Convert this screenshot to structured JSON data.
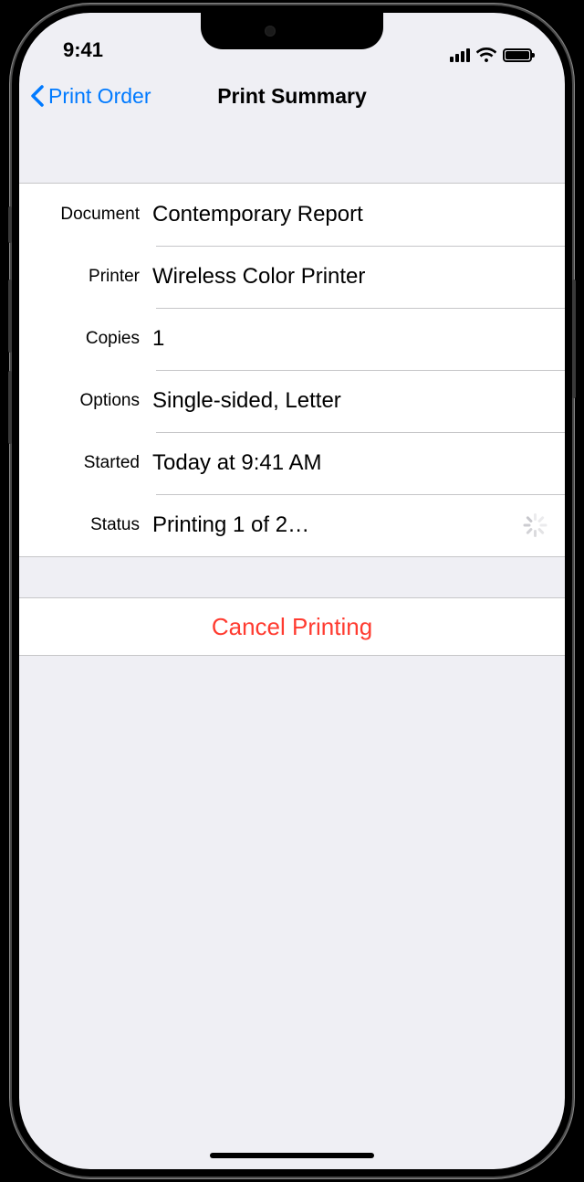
{
  "status_bar": {
    "time": "9:41"
  },
  "nav": {
    "back_label": "Print Order",
    "title": "Print Summary"
  },
  "rows": {
    "document": {
      "label": "Document",
      "value": "Contemporary Report"
    },
    "printer": {
      "label": "Printer",
      "value": "Wireless Color Printer"
    },
    "copies": {
      "label": "Copies",
      "value": "1"
    },
    "options": {
      "label": "Options",
      "value": "Single-sided, Letter"
    },
    "started": {
      "label": "Started",
      "value": "Today at 9:41 AM"
    },
    "status": {
      "label": "Status",
      "value": "Printing 1 of 2…"
    }
  },
  "actions": {
    "cancel_label": "Cancel Printing"
  }
}
